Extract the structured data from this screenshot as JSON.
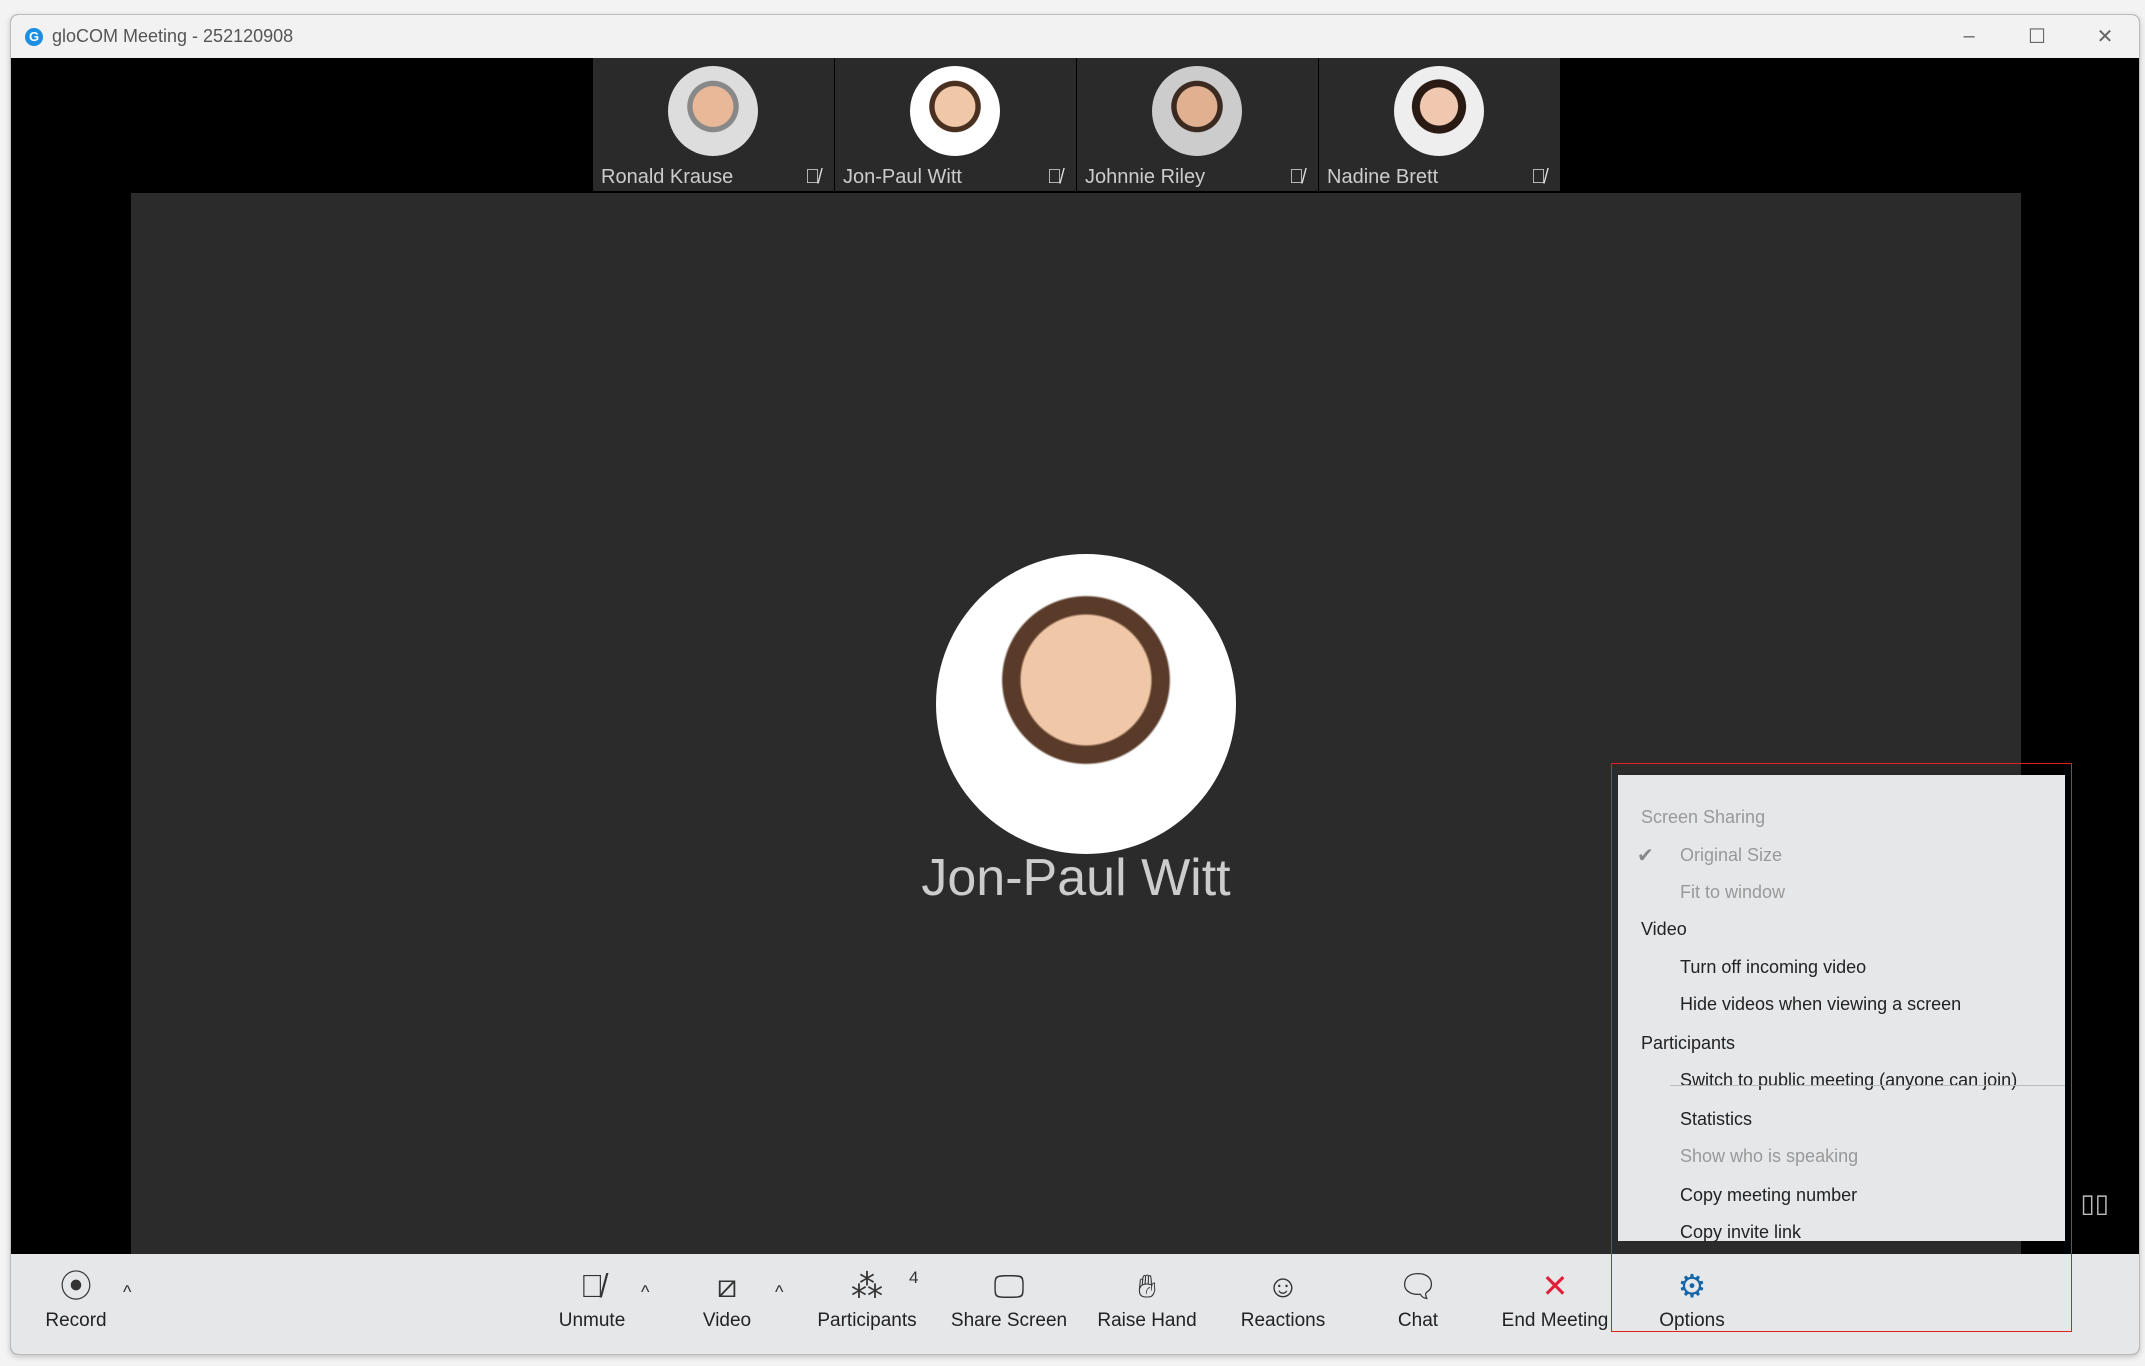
{
  "window": {
    "title": "gloCOM Meeting - 252120908",
    "logo": "G"
  },
  "thumbnails": [
    {
      "name": "Ronald Krause",
      "muted": true
    },
    {
      "name": "Jon-Paul Witt",
      "muted": true
    },
    {
      "name": "Johnnie Riley",
      "muted": true
    },
    {
      "name": "Nadine Brett",
      "muted": true
    }
  ],
  "speaker": {
    "name": "Jon-Paul Witt"
  },
  "toolbar": {
    "record": "Record",
    "unmute": "Unmute",
    "video": "Video",
    "participants": "Participants",
    "participants_count": "4",
    "share_screen": "Share Screen",
    "raise_hand": "Raise Hand",
    "reactions": "Reactions",
    "chat": "Chat",
    "end_meeting": "End Meeting",
    "options": "Options"
  },
  "options_menu": {
    "screen_sharing": "Screen Sharing",
    "original_size": "Original Size",
    "original_size_checked": true,
    "fit_to_window": "Fit to window",
    "video": "Video",
    "turn_off_incoming": "Turn off incoming video",
    "hide_videos": "Hide videos when viewing a screen",
    "participants": "Participants",
    "switch_public": "Switch to public meeting (anyone can join)",
    "statistics": "Statistics",
    "show_speaking": "Show who is speaking",
    "copy_number": "Copy meeting number",
    "copy_link": "Copy invite link"
  },
  "colors": {
    "accent": "#1565a8",
    "end_meeting": "#e0203a",
    "highlight_box": "#e02020"
  }
}
